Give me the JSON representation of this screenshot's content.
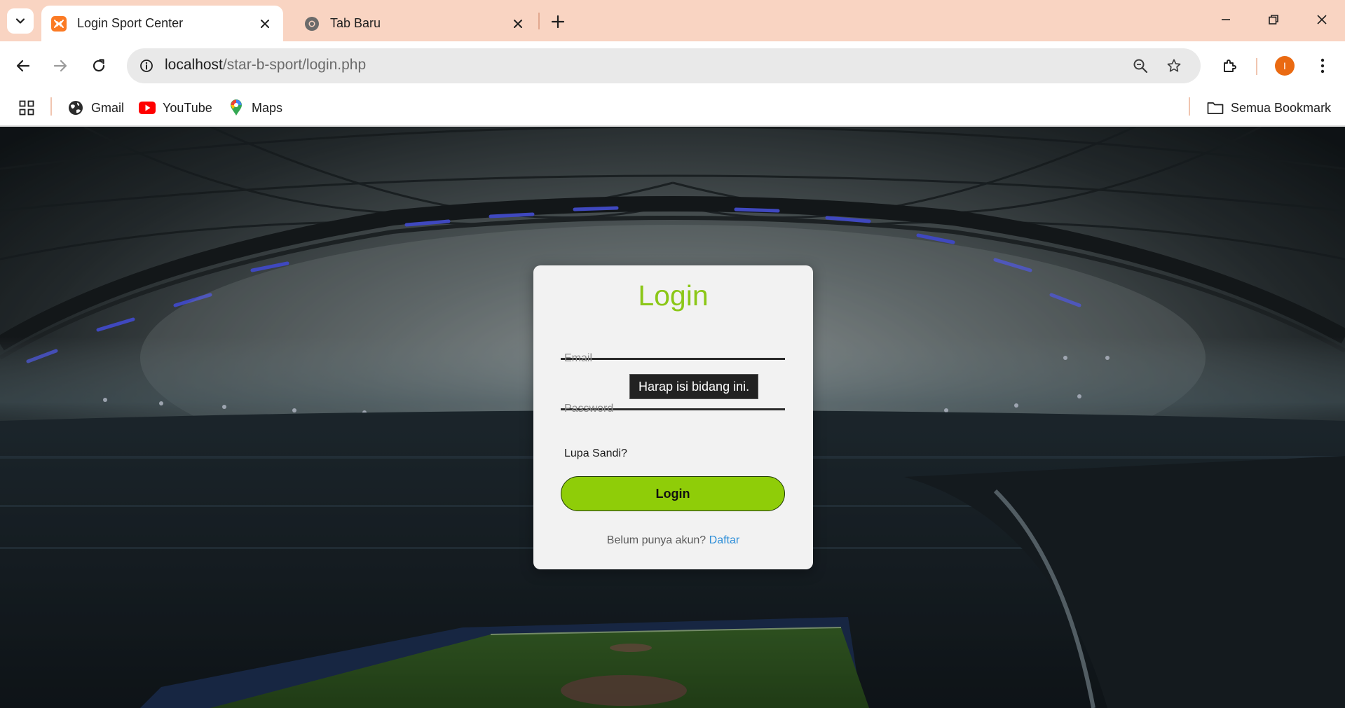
{
  "browser": {
    "tabs": [
      {
        "title": "Login Sport Center",
        "active": true,
        "icon": "xampp-icon"
      },
      {
        "title": "Tab Baru",
        "active": false,
        "icon": "chrome-icon"
      }
    ],
    "url": {
      "host": "localhost",
      "path": "/star-b-sport/login.php"
    },
    "profile_initial": "I",
    "accent_color": "#f9d4c2"
  },
  "bookmarks": {
    "items": [
      {
        "label": "Gmail",
        "icon": "globe-icon"
      },
      {
        "label": "YouTube",
        "icon": "youtube-icon"
      },
      {
        "label": "Maps",
        "icon": "maps-pin-icon"
      }
    ],
    "all_bookmarks_label": "Semua Bookmark"
  },
  "login": {
    "title": "Login",
    "email_placeholder": "Email",
    "password_placeholder": "Password",
    "validation_tooltip": "Harap isi bidang ini.",
    "forgot_label": "Lupa Sandi?",
    "submit_label": "Login",
    "register_prompt": "Belum punya akun?",
    "register_link": "Daftar",
    "title_color": "#8bc717",
    "button_color": "#8fcd08"
  }
}
